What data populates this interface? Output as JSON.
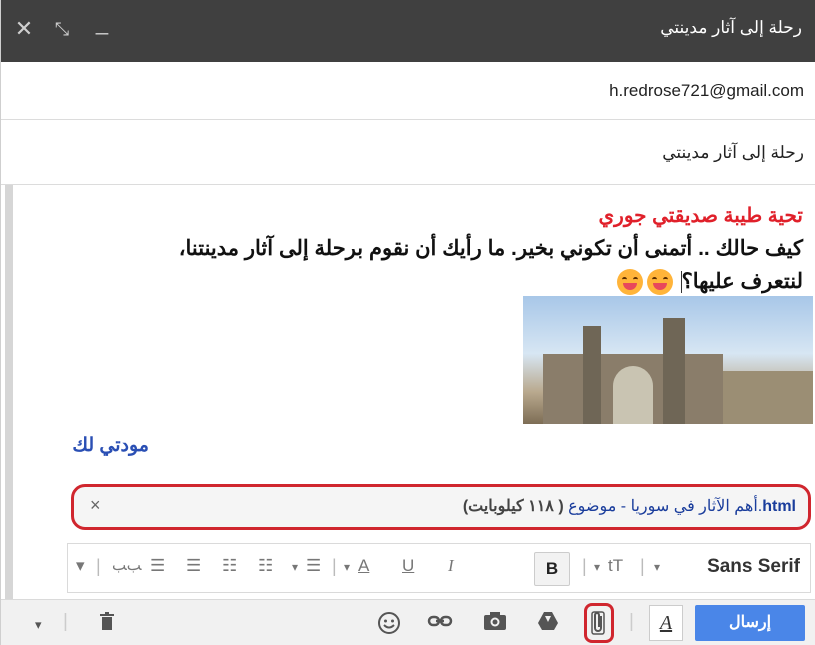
{
  "window": {
    "title": "رحلة إلى آثار مدينتي",
    "close_icon": "✕",
    "expand_icon": "⤡",
    "minimize_icon": "_"
  },
  "recipients": {
    "to": "h.redrose721@gmail.com"
  },
  "subject": {
    "value": "رحلة إلى آثار مدينتي"
  },
  "message": {
    "greeting": "تحية طيبة صديقتي جوري",
    "line1": "كيف حالك .. أتمنى أن تكوني بخير. ما رأيك أن نقوم برحلة إلى آثار مدينتنا،",
    "line2": "لنتعرف عليها؟",
    "signature": "مودتي لك",
    "image": "ruins-photo"
  },
  "attachment": {
    "extension": "html",
    "name": "أهم الآثار في سوريا - موضوع",
    "size": "( ١١٨ كيلوبايت)",
    "remove_icon": "×"
  },
  "formatting": {
    "font": "Sans Serif",
    "size_icon": "tT",
    "bold": "B",
    "italic": "I",
    "underline": "U",
    "text_color": "A"
  },
  "bottom": {
    "send_label": "إرسال",
    "format_toggle": "A"
  },
  "colors": {
    "titlebar": "#404040",
    "send": "#4a86e8",
    "greeting": "#e0202a",
    "highlight": "#d0262e",
    "link": "#1a3d9c"
  }
}
